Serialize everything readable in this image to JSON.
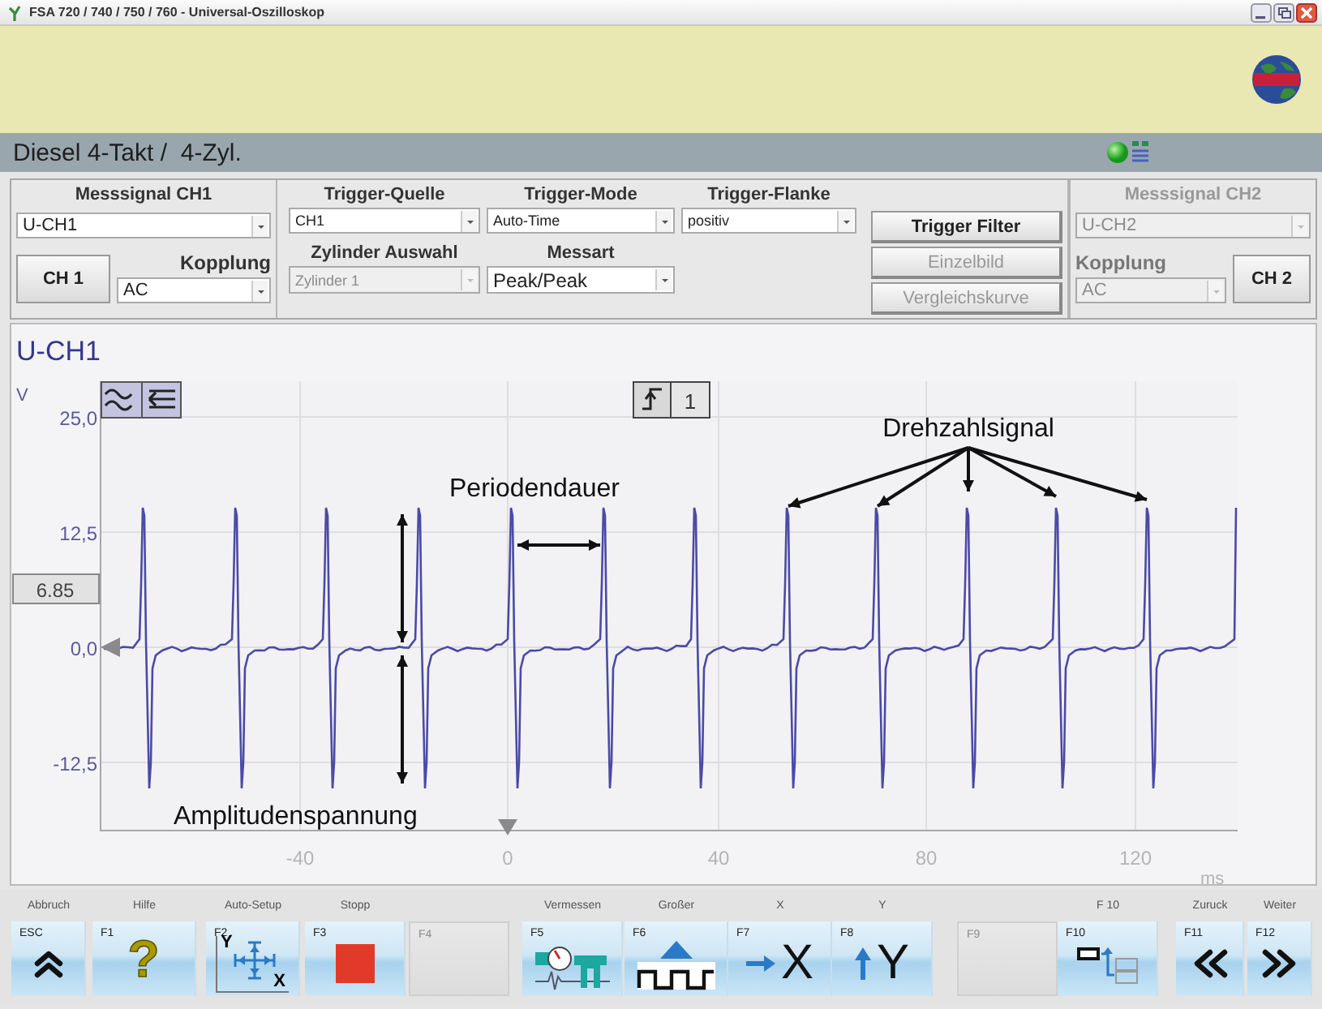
{
  "window": {
    "title": "FSA 720 / 740 / 750 / 760 - Universal-Oszilloskop"
  },
  "header": {
    "title": "Diesel 4-Takt /  4-Zyl."
  },
  "channel1": {
    "heading": "Messsignal CH1",
    "disabled": false,
    "signal": {
      "value": "U-CH1",
      "disabled": false
    },
    "button": "CH 1",
    "coupling_label": "Kopplung",
    "coupling": {
      "value": "AC",
      "disabled": false
    }
  },
  "trigger": {
    "fields": [
      {
        "label": "Trigger-Quelle",
        "value": "CH1",
        "disabled": false
      },
      {
        "label": "Trigger-Mode",
        "value": "Auto-Time",
        "disabled": false
      },
      {
        "label": "Trigger-Flanke",
        "value": "positiv",
        "disabled": false
      },
      {
        "label": "Zylinder Auswahl",
        "value": "Zylinder 1",
        "disabled": true
      },
      {
        "label": "Messart",
        "value": "Peak/Peak",
        "disabled": false
      }
    ]
  },
  "buttons": [
    {
      "label": "Trigger Filter",
      "disabled": false
    },
    {
      "label": "Einzelbild",
      "disabled": true
    },
    {
      "label": "Vergleichskurve",
      "disabled": true
    }
  ],
  "channel2": {
    "heading": "Messsignal CH2",
    "disabled": true,
    "signal": {
      "value": "U-CH2",
      "disabled": true
    },
    "button": "CH 2",
    "coupling_label": "Kopplung",
    "coupling": {
      "value": "AC",
      "disabled": true
    }
  },
  "scope": {
    "title": "U-CH1",
    "y_unit": "V",
    "y_ticks": [
      "25,0",
      "12,5",
      "0,0",
      "-12,5"
    ],
    "x_ticks": [
      "-40",
      "0",
      "40",
      "80",
      "120"
    ],
    "x_unit": "ms",
    "cursor_value": "6.85",
    "trigger_channel": "1",
    "annotations": [
      {
        "kind": "period",
        "text": "Periodendauer"
      },
      {
        "kind": "amplitude",
        "text": "Amplitudenspannung"
      },
      {
        "kind": "rpm",
        "text": "Drehzahlsignal"
      }
    ]
  },
  "keys": [
    {
      "label": "Abbruch",
      "key": "ESC",
      "kind": "back",
      "disabled": false
    },
    {
      "label": "Hilfe",
      "key": "F1",
      "kind": "help",
      "glyph": "?",
      "disabled": false
    },
    {
      "label": "Auto-Setup",
      "key": "F2",
      "kind": "autoscale",
      "axis_labels": [
        "Y",
        "X"
      ],
      "disabled": false
    },
    {
      "label": "Stopp",
      "key": "F3",
      "kind": "stop",
      "disabled": false
    },
    {
      "key": "F4",
      "kind": "blank",
      "disabled": true
    },
    {
      "label": "Vermessen",
      "key": "F5",
      "kind": "measure",
      "disabled": false
    },
    {
      "label": "Großer",
      "key": "F6",
      "kind": "zoom",
      "disabled": false
    },
    {
      "label": "X",
      "key": "F7",
      "kind": "xaxis",
      "glyph": "X",
      "disabled": false
    },
    {
      "label": "Y",
      "key": "F8",
      "kind": "yaxis",
      "glyph": "Y",
      "disabled": false
    },
    {
      "key": "F9",
      "kind": "blank",
      "disabled": true
    },
    {
      "label": "F 10",
      "key": "F10",
      "kind": "layout",
      "disabled": false
    },
    {
      "label": "Zuruck",
      "key": "F11",
      "kind": "previous",
      "disabled": false
    },
    {
      "label": "Weiter",
      "key": "F12",
      "kind": "next",
      "disabled": false
    }
  ]
}
